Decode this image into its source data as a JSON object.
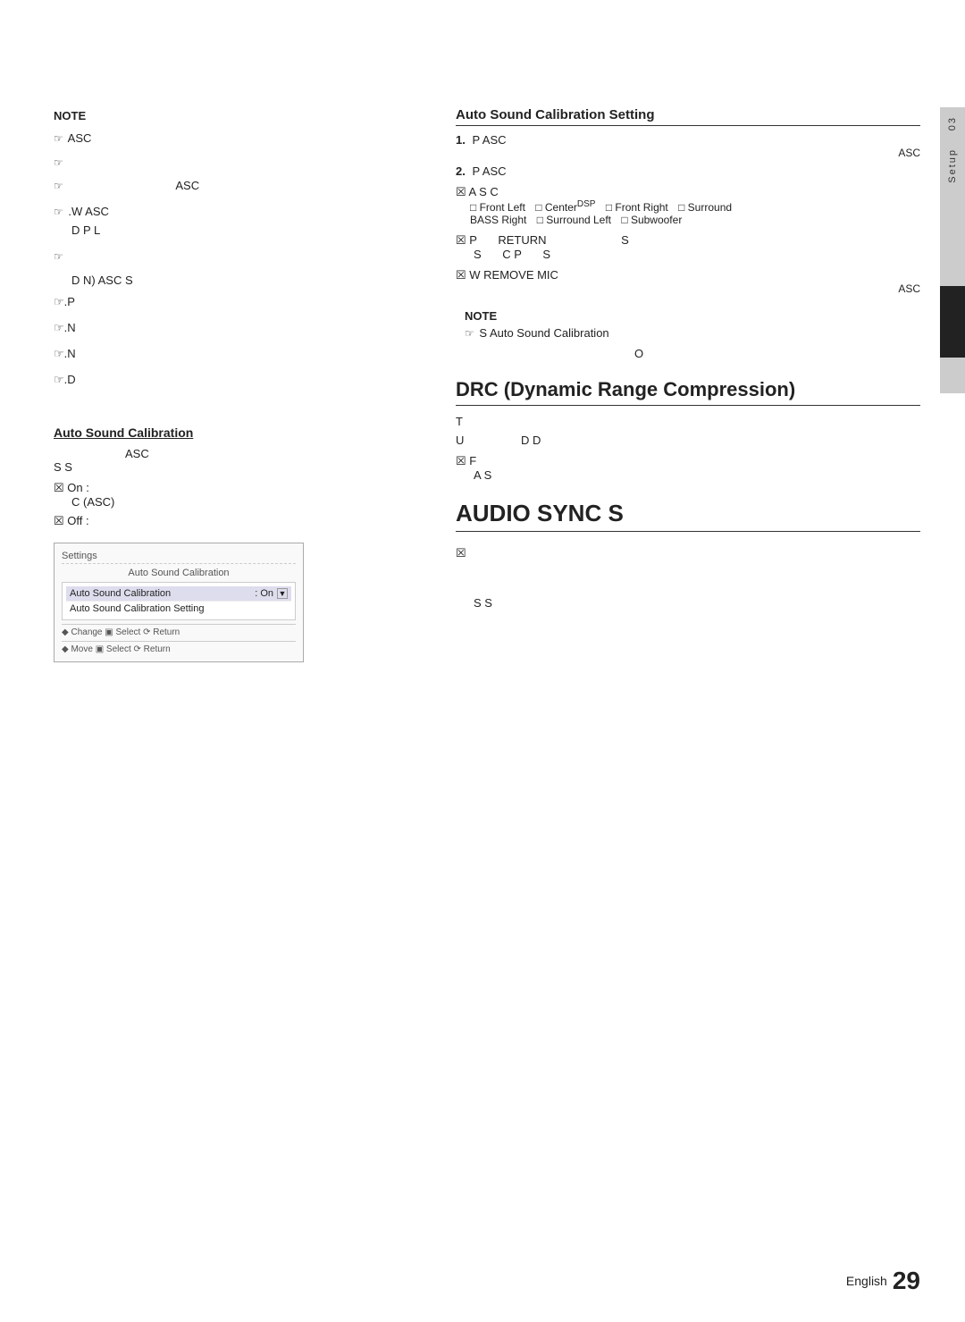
{
  "page": {
    "number": "29",
    "language": "English",
    "chapter": "03",
    "chapter_label": "Setup"
  },
  "left_col": {
    "note_label": "NOTE",
    "note_icon": "☞",
    "asc_line1": "ASC",
    "note_icon2": "☞",
    "note_icon3": "☞",
    "asc_label1": "ASC",
    "note_icon4": "☞",
    "asc_w_label": "W    ASC",
    "d_p_l": "D           P           L",
    "note_icon5": "☞",
    "d_n_asc": "D          N)          ASC S",
    "p_label": "☞.P",
    "note_icon6": "☞",
    "n_label1": "☞.N",
    "note_icon7": "☞",
    "n_label2": "☞.N",
    "note_icon8": "☞",
    "d_label": "☞.D",
    "auto_sound_title": "Auto Sound Calibration",
    "asc_desc": "ASC",
    "s_s": "S                    S",
    "on_label": "☒ On :",
    "on_desc": "C                                    (ASC)",
    "off_label": "☒ Off :",
    "screenshot": {
      "settings_label": "Settings",
      "section_label": "Auto Sound Calibration",
      "menu_items": [
        {
          "name": "Auto Sound Calibration",
          "value": "On",
          "has_arrow": true
        },
        {
          "name": "Auto Sound Calibration Setting",
          "value": "",
          "has_arrow": false
        }
      ],
      "footer1": "◆ Change   ▣ Select   ⟳ Return",
      "footer2": "◆ Move      ▣ Select   ⟳ Return"
    }
  },
  "right_col": {
    "setting_title": "Auto Sound Calibration Setting",
    "step1_label": "1.",
    "step1_text": "P                       ASC",
    "step1_sub": "ASC",
    "step2_label": "2.",
    "step2_text": "P                       ASC",
    "checkbox_a": "☒ A         S          C",
    "front_left": "Front Left",
    "center": "Center",
    "front_right": "Front Right",
    "surround": "Surround",
    "bass_right": "BASS Right",
    "surround_left": "Surround Left",
    "subwoofer": "Subwoofer",
    "dsp": "DSP",
    "checkbox_p": "☒ P          RETURN",
    "s_label": "S",
    "c_p": "C       P",
    "s_end": "S",
    "checkbox_w": "☒ W                                 REMOVE MIC",
    "asc_end": "ASC",
    "note_section": {
      "note_label": "NOTE",
      "note_icon": "☞",
      "s_text": "S                              Auto Sound Calibration"
    },
    "o_text": "O",
    "drc_title": "DRC (Dynamic Range Compression)",
    "t_text": "T",
    "u_label": "U",
    "d_d": "D                      D",
    "checkbox_f": "☒                                            F",
    "a_s": "A             S",
    "audio_sync_title": "AUDIO SYNC  S",
    "audio_sync_desc1": "☒",
    "audio_sync_s_s": "S              S"
  }
}
